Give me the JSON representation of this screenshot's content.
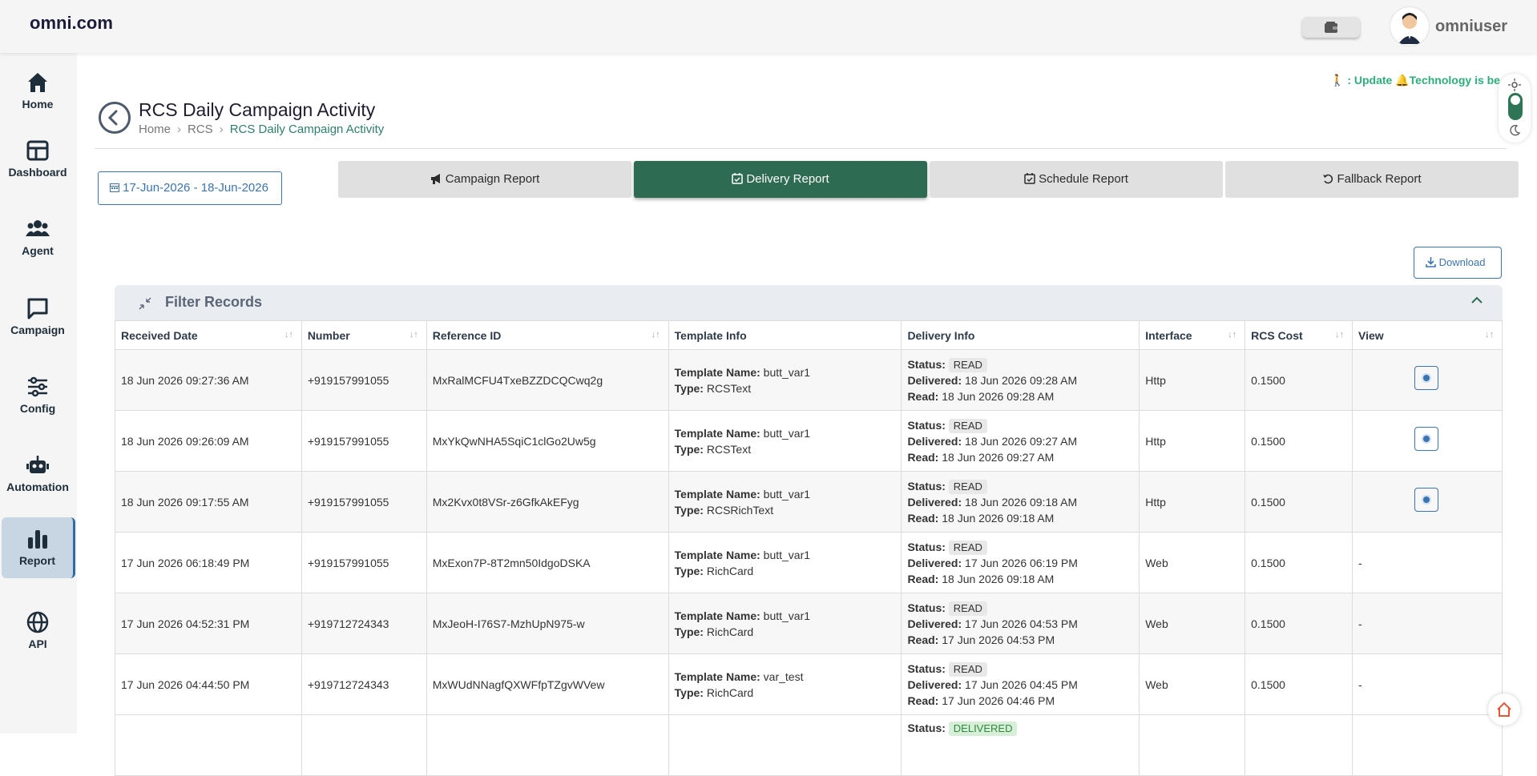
{
  "brand": "omni.com",
  "user": {
    "name": "omniuser"
  },
  "sidebar": {
    "items": [
      {
        "label": "Home",
        "icon": "home-icon"
      },
      {
        "label": "Dashboard",
        "icon": "dashboard-icon"
      },
      {
        "label": "Agent",
        "icon": "users-icon"
      },
      {
        "label": "Campaign",
        "icon": "chat-icon"
      },
      {
        "label": "Config",
        "icon": "sliders-icon"
      },
      {
        "label": "Automation",
        "icon": "robot-icon"
      },
      {
        "label": "Report",
        "icon": "bar-chart-icon"
      },
      {
        "label": "API",
        "icon": "globe-icon"
      }
    ]
  },
  "ticker": {
    "prefix": ": Update",
    "text": "Technology is be"
  },
  "page": {
    "title": "RCS Daily Campaign Activity",
    "breadcrumb": [
      "Home",
      "RCS",
      "RCS Daily Campaign Activity"
    ]
  },
  "date_range": "17-Jun-2026 - 18-Jun-2026",
  "tabs": [
    "Campaign Report",
    "Delivery Report",
    "Schedule Report",
    "Fallback Report"
  ],
  "download_label": "Download",
  "filter": {
    "title": "Filter Records"
  },
  "table": {
    "headers": [
      "Received Date",
      "Number",
      "Reference ID",
      "Template Info",
      "Delivery Info",
      "Interface",
      "RCS Cost",
      "View"
    ],
    "labels": {
      "template_name": "Template Name:",
      "type": "Type:",
      "status": "Status:",
      "delivered": "Delivered:",
      "read": "Read:"
    },
    "rows": [
      {
        "received": "18 Jun 2026 09:27:36 AM",
        "number": "+919157991055",
        "ref": "MxRalMCFU4TxeBZZDCQCwq2g",
        "template": "butt_var1",
        "type": "RCSText",
        "status": "READ",
        "delivered": "18 Jun 2026 09:28 AM",
        "read": "18 Jun 2026 09:28 AM",
        "interface": "Http",
        "cost": "0.1500",
        "view": ""
      },
      {
        "received": "18 Jun 2026 09:26:09 AM",
        "number": "+919157991055",
        "ref": "MxYkQwNHA5SqiC1clGo2Uw5g",
        "template": "butt_var1",
        "type": "RCSText",
        "status": "READ",
        "delivered": "18 Jun 2026 09:27 AM",
        "read": "18 Jun 2026 09:27 AM",
        "interface": "Http",
        "cost": "0.1500",
        "view": ""
      },
      {
        "received": "18 Jun 2026 09:17:55 AM",
        "number": "+919157991055",
        "ref": "Mx2Kvx0t8VSr-z6GfkAkEFyg",
        "template": "butt_var1",
        "type": "RCSRichText",
        "status": "READ",
        "delivered": "18 Jun 2026 09:18 AM",
        "read": "18 Jun 2026 09:18 AM",
        "interface": "Http",
        "cost": "0.1500",
        "view": ""
      },
      {
        "received": "17 Jun 2026 06:18:49 PM",
        "number": "+919157991055",
        "ref": "MxExon7P-8T2mn50IdgoDSKA",
        "template": "butt_var1",
        "type": "RichCard",
        "status": "READ",
        "delivered": "17 Jun 2026 06:19 PM",
        "read": "18 Jun 2026 09:18 AM",
        "interface": "Web",
        "cost": "0.1500",
        "view": "-"
      },
      {
        "received": "17 Jun 2026 04:52:31 PM",
        "number": "+919712724343",
        "ref": "MxJeoH-I76S7-MzhUpN975-w",
        "template": "butt_var1",
        "type": "RichCard",
        "status": "READ",
        "delivered": "17 Jun 2026 04:53 PM",
        "read": "17 Jun 2026 04:53 PM",
        "interface": "Web",
        "cost": "0.1500",
        "view": "-"
      },
      {
        "received": "17 Jun 2026 04:44:50 PM",
        "number": "+919712724343",
        "ref": "MxWUdNNagfQXWFfpTZgvWVew",
        "template": "var_test",
        "type": "RichCard",
        "status": "READ",
        "delivered": "17 Jun 2026 04:45 PM",
        "read": "17 Jun 2026 04:46 PM",
        "interface": "Web",
        "cost": "0.1500",
        "view": "-"
      }
    ],
    "partial_row": {
      "status": "DELIVERED"
    }
  },
  "colors": {
    "accent": "#2d6b52",
    "link": "#3b74b0",
    "ticker": "#2eae7a"
  }
}
